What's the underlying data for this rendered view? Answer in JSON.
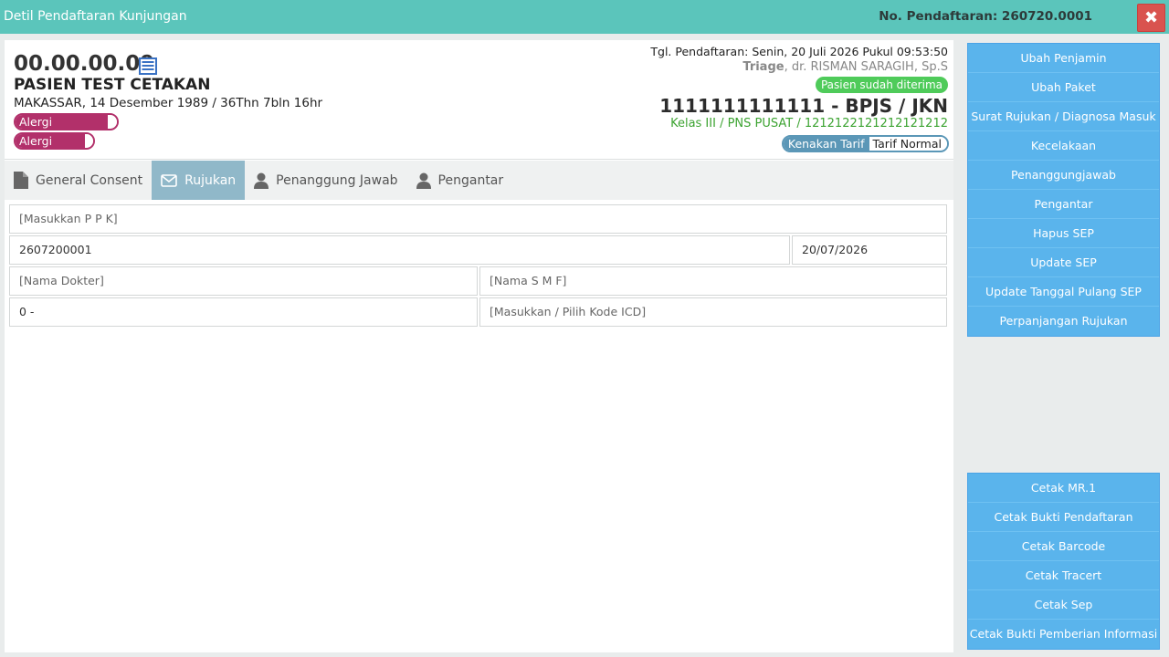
{
  "window": {
    "title": "Detil Pendaftaran Kunjungan",
    "registration_no": "No. Pendaftaran: 260720.0001",
    "close_glyph": "✖"
  },
  "patient": {
    "rm_number": "00.00.00.09",
    "name": "PASIEN TEST CETAKAN",
    "birth_info": "MAKASSAR, 14 Desember 1989 / 36Thn 7bln 16hr",
    "allergies": [
      "Alergi Makanan",
      "Alergi Obat"
    ]
  },
  "registration": {
    "date_text": "Tgl. Pendaftaran: Senin, 20 Juli 2026 Pukul 09:53:50",
    "unit": "Triage",
    "doctor": ", dr. RISMAN SARAGIH, Sp.S",
    "status": "Pasien sudah diterima",
    "bpjs": "1111111111111 - BPJS / JKN",
    "kelas": "Kelas III / PNS PUSAT / 1212122121212121212",
    "tarif_label": "Kenakan Tarif",
    "tarif_value": "Tarif Normal"
  },
  "tabs": [
    {
      "label": "General Consent",
      "icon": "document-icon"
    },
    {
      "label": "Rujukan",
      "icon": "envelope-icon"
    },
    {
      "label": "Penanggung Jawab",
      "icon": "user-icon"
    },
    {
      "label": "Pengantar",
      "icon": "user-icon"
    }
  ],
  "active_tab": "Rujukan",
  "form": {
    "ppk_placeholder": "[Masukkan P P K]",
    "rujukan_no": "2607200001",
    "rujukan_date": "20/07/2026",
    "dokter_placeholder": "[Nama Dokter]",
    "smf_placeholder": "[Nama S M F]",
    "code_value": "0 -",
    "icd_placeholder": "[Masukkan / Pilih Kode ICD]"
  },
  "sidebar": {
    "group1": [
      "Ubah Penjamin",
      "Ubah Paket",
      "Surat Rujukan / Diagnosa Masuk",
      "Kecelakaan",
      "Penanggungjawab",
      "Pengantar",
      "Hapus SEP",
      "Update SEP",
      "Update Tanggal Pulang SEP",
      "Perpanjangan Rujukan"
    ],
    "group2": [
      "Cetak MR.1",
      "Cetak Bukti Pendaftaran",
      "Cetak Barcode",
      "Cetak Tracert",
      "Cetak Sep",
      "Cetak Bukti Pemberian Informasi"
    ]
  },
  "colors": {
    "titlebar": "#5bc5bb",
    "close": "#d9534f",
    "sidebar_button": "#5ab4ec",
    "active_tab": "#90b8c9",
    "allergy": "#b2306a",
    "status": "#4fcb5a",
    "kelas_text": "#3ca331"
  }
}
